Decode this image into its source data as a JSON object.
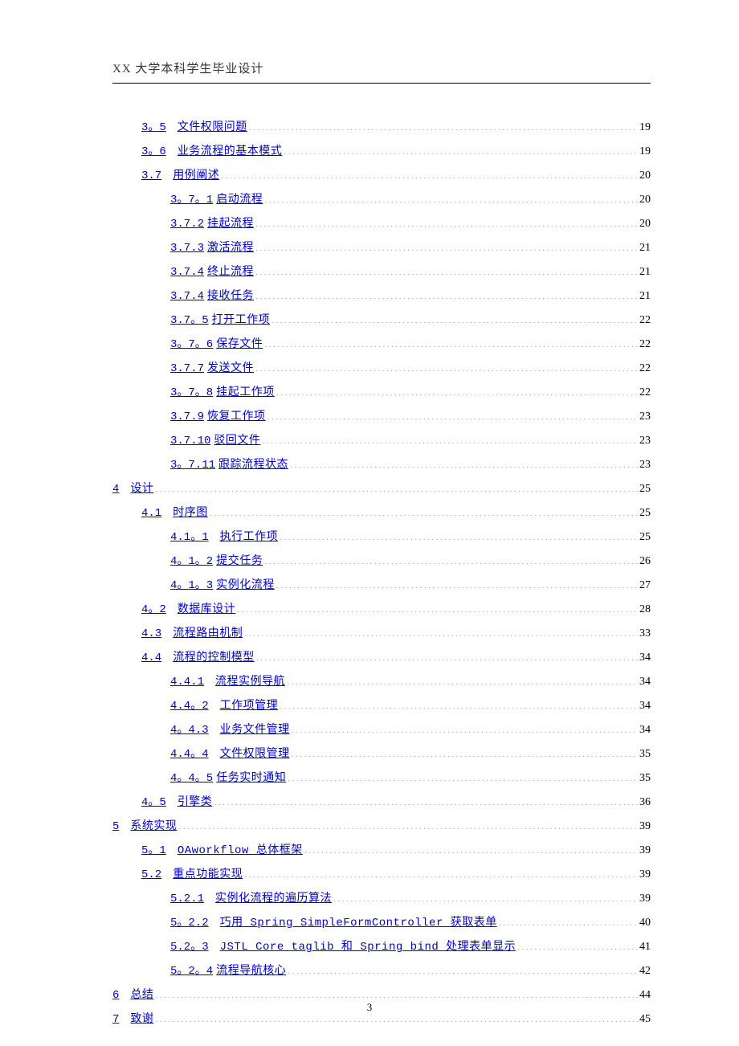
{
  "header": "XX 大学本科学生毕业设计",
  "page_number": "3",
  "toc": [
    {
      "indent": 1,
      "num": "3。5",
      "title": "文件权限问题",
      "page": "19"
    },
    {
      "indent": 1,
      "num": "3。6",
      "title": "业务流程的基本模式",
      "page": "19"
    },
    {
      "indent": 1,
      "num": "3.7",
      "title": "用例阐述",
      "page": "20"
    },
    {
      "indent": 2,
      "num": "3。7。1",
      "title": "启动流程",
      "page": "20",
      "nogap": true
    },
    {
      "indent": 2,
      "num": "3.7.2",
      "title": "挂起流程",
      "page": "20",
      "nogap": true
    },
    {
      "indent": 2,
      "num": "3.7.3",
      "title": "激活流程",
      "page": "21",
      "nogap": true
    },
    {
      "indent": 2,
      "num": "3.7.4",
      "title": "终止流程",
      "page": "21",
      "nogap": true
    },
    {
      "indent": 2,
      "num": "3.7.4",
      "title": "接收任务",
      "page": "21",
      "nogap": true
    },
    {
      "indent": 2,
      "num": "3.7。5",
      "title": "打开工作项",
      "page": "22",
      "nogap": true
    },
    {
      "indent": 2,
      "num": "3。7。6",
      "title": "保存文件",
      "page": "22",
      "nogap": true
    },
    {
      "indent": 2,
      "num": "3.7.7",
      "title": "发送文件",
      "page": "22",
      "nogap": true
    },
    {
      "indent": 2,
      "num": "3。7。8",
      "title": "挂起工作项",
      "page": "22",
      "nogap": true
    },
    {
      "indent": 2,
      "num": "3.7.9",
      "title": "恢复工作项",
      "page": "23",
      "nogap": true
    },
    {
      "indent": 2,
      "num": "3.7.10",
      "title": "驳回文件",
      "page": "23",
      "nogap": true
    },
    {
      "indent": 2,
      "num": "3。7.11",
      "title": "跟踪流程状态",
      "page": "23",
      "nogap": true
    },
    {
      "indent": 0,
      "num": "4",
      "title": "设计",
      "page": "25"
    },
    {
      "indent": 1,
      "num": "4.1",
      "title": "时序图",
      "page": "25"
    },
    {
      "indent": 2,
      "num": "4.1。1",
      "title": "执行工作项",
      "page": "25"
    },
    {
      "indent": 2,
      "num": "4。1。2",
      "title": "提交任务",
      "page": "26",
      "nogap": true
    },
    {
      "indent": 2,
      "num": "4。1。3",
      "title": "实例化流程",
      "page": "27",
      "nogap": true
    },
    {
      "indent": 1,
      "num": "4。2",
      "title": "数据库设计",
      "page": "28"
    },
    {
      "indent": 1,
      "num": "4.3",
      "title": "流程路由机制",
      "page": "33"
    },
    {
      "indent": 1,
      "num": "4.4",
      "title": "流程的控制模型",
      "page": "34"
    },
    {
      "indent": 2,
      "num": "4.4.1",
      "title": "流程实例导航",
      "page": "34"
    },
    {
      "indent": 2,
      "num": "4.4。2",
      "title": "工作项管理",
      "page": "34"
    },
    {
      "indent": 2,
      "num": "4。4.3",
      "title": "业务文件管理",
      "page": "34"
    },
    {
      "indent": 2,
      "num": "4.4。4",
      "title": "文件权限管理",
      "page": "35"
    },
    {
      "indent": 2,
      "num": "4。4。5",
      "title": "任务实时通知",
      "page": "35",
      "nogap": true
    },
    {
      "indent": 1,
      "num": "4。5",
      "title": "引擎类",
      "page": "36"
    },
    {
      "indent": 0,
      "num": "5",
      "title": "系统实现",
      "page": "39"
    },
    {
      "indent": 1,
      "num": "5。1",
      "title": "OAworkflow 总体框架",
      "page": "39"
    },
    {
      "indent": 1,
      "num": "5.2",
      "title": "重点功能实现",
      "page": "39"
    },
    {
      "indent": 2,
      "num": "5.2.1",
      "title": "实例化流程的遍历算法",
      "page": "39"
    },
    {
      "indent": 2,
      "num": "5。2.2",
      "title": "巧用 Spring SimpleFormController 获取表单",
      "page": "40"
    },
    {
      "indent": 2,
      "num": "5.2。3",
      "title": "JSTL Core taglib 和 Spring bind 处理表单显示",
      "page": "41"
    },
    {
      "indent": 2,
      "num": "5。2。4",
      "title": "流程导航核心",
      "page": "42",
      "nogap": true
    },
    {
      "indent": 0,
      "num": "6",
      "title": "总结",
      "page": "44"
    },
    {
      "indent": 0,
      "num": "7",
      "title": "致谢",
      "page": "45"
    }
  ]
}
